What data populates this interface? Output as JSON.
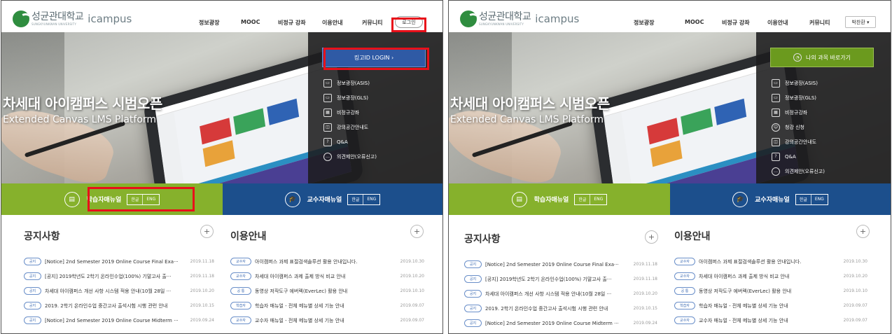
{
  "common": {
    "logo_ko": "성균관대학교",
    "logo_sub": "SUNGKYUNKWAN UNIVERSITY",
    "logo_en": "icampus",
    "nav": [
      "정보광장",
      "MOOC",
      "비정규 강좌",
      "이용안내",
      "커뮤니티"
    ],
    "hero_title": "차세대 아이캠퍼스 시범오픈",
    "hero_subtitle": "Extended Canvas LMS Platform",
    "student_manual": "학습자매뉴얼",
    "professor_manual": "교수자매뉴얼",
    "lang_ko": "한글",
    "lang_en": "ENG",
    "notice_title": "공지사항",
    "guide_title": "이용안내",
    "plus": "+"
  },
  "left": {
    "login_button": "로그인",
    "quick_button": "킹고ID LOGIN ›",
    "quick_links": [
      {
        "icon": "monitor-icon",
        "label": "정보광장(ASIS)"
      },
      {
        "icon": "monitor-icon",
        "label": "정보광장(GLS)"
      },
      {
        "icon": "building-icon",
        "label": "비정규강좌"
      },
      {
        "icon": "map-icon",
        "label": "강의공간안내도"
      },
      {
        "icon": "qa-icon",
        "label": "Q&A"
      },
      {
        "icon": "chat-icon",
        "label": "의견제안(오류신고)"
      }
    ]
  },
  "right": {
    "user_menu": "박찬환 ▾",
    "quick_button": "나의 과목 바로가기",
    "quick_links": [
      {
        "icon": "monitor-icon",
        "label": "정보광장(ASIS)"
      },
      {
        "icon": "monitor-icon",
        "label": "정보광장(GLS)"
      },
      {
        "icon": "building-icon",
        "label": "비정규강좌"
      },
      {
        "icon": "people-icon",
        "label": "청강 신청"
      },
      {
        "icon": "map-icon",
        "label": "강의공간안내도"
      },
      {
        "icon": "qa-icon",
        "label": "Q&A"
      },
      {
        "icon": "chat-icon",
        "label": "의견제안(오류신고)"
      }
    ]
  },
  "notices": [
    {
      "tag": "공지",
      "text": "[Notice] 2nd Semester 2019 Online Course Final Exa···",
      "date": "2019.11.18"
    },
    {
      "tag": "공지",
      "text": "[공지] 2019학년도 2학기 온라인수업(100%) 기말고사 출···",
      "date": "2019.11.18"
    },
    {
      "tag": "공지",
      "text": "차세대 아이캠퍼스 개선 사항 시스템 적용 안내(10월 28일 ···",
      "date": "2019.10.20"
    },
    {
      "tag": "공지",
      "text": "2019. 2학기 온라인수업 중간고사 출석시험 시행 관련 안내",
      "date": "2019.10.15"
    },
    {
      "tag": "공지",
      "text": "[Notice] 2nd Semester 2019 Online Course Midterm ···",
      "date": "2019.09.24"
    }
  ],
  "guides": [
    {
      "tag": "교수자",
      "text": "아이캠퍼스 과제 표절검색솔루션 활용 안내입니다.",
      "date": "2019.10.30"
    },
    {
      "tag": "교수자",
      "text": "차세대 아이캠퍼스 과제 출제 방식 비교 안내",
      "date": "2019.10.20"
    },
    {
      "tag": "공 통",
      "text": "동영상 저작도구 에버렉(EverLec) 활용 안내",
      "date": "2019.10.10"
    },
    {
      "tag": "학습자",
      "text": "학습자 매뉴얼 - 전체 메뉴별 상세 기능 안내",
      "date": "2019.09.07"
    },
    {
      "tag": "교수자",
      "text": "교수자 매뉴얼 - 전체 메뉴별 상세 기능 안내",
      "date": "2019.09.07"
    }
  ]
}
